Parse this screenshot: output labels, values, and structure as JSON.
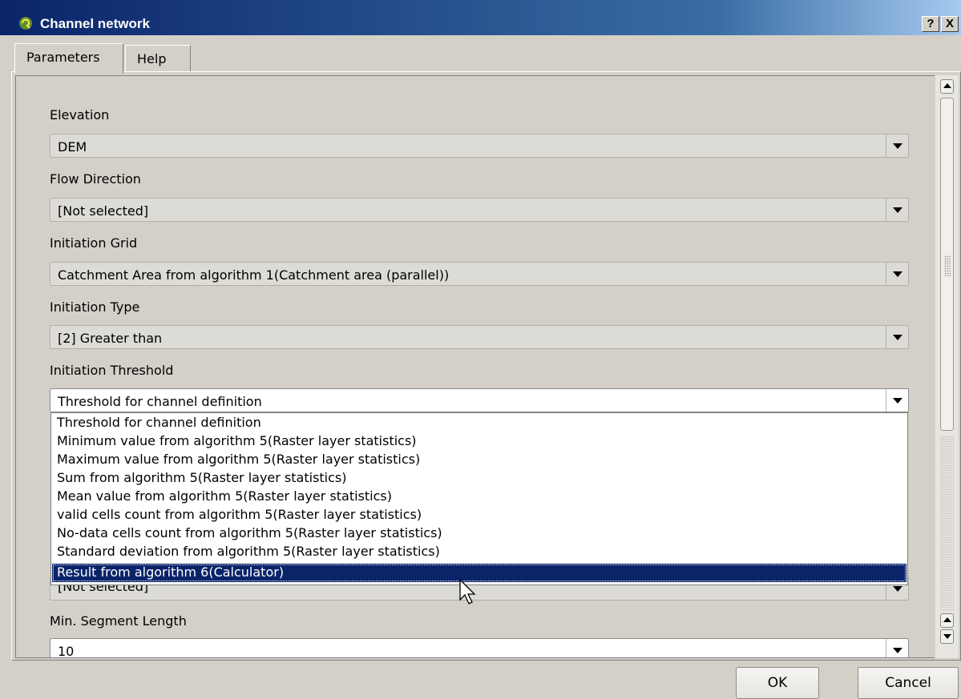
{
  "window": {
    "title": "Channel network",
    "help_button": "?",
    "close_button": "X"
  },
  "tabs": [
    {
      "label": "Parameters",
      "active": true
    },
    {
      "label": "Help",
      "active": false
    }
  ],
  "form": {
    "fields": [
      {
        "label": "Elevation",
        "value": "DEM"
      },
      {
        "label": "Flow Direction",
        "value": "[Not selected]"
      },
      {
        "label": "Initiation Grid",
        "value": "Catchment Area from algorithm 1(Catchment area (parallel))"
      },
      {
        "label": "Initiation Type",
        "value": "[2] Greater than"
      },
      {
        "label": "Initiation Threshold",
        "value": "Threshold for channel definition"
      }
    ],
    "hidden_field_value": "[Not selected]",
    "min_segment": {
      "label": "Min. Segment Length",
      "value": "10"
    }
  },
  "dropdown": {
    "items": [
      "Threshold for channel definition",
      "Minimum value from algorithm 5(Raster layer statistics)",
      "Maximum value from algorithm 5(Raster layer statistics)",
      "Sum from algorithm 5(Raster layer statistics)",
      "Mean value from algorithm 5(Raster layer statistics)",
      "valid cells count from algorithm 5(Raster layer statistics)",
      "No-data cells count from algorithm 5(Raster layer statistics)",
      "Standard deviation from algorithm 5(Raster layer statistics)",
      "Result from algorithm 6(Calculator)"
    ],
    "selected_index": 8
  },
  "buttons": {
    "ok": "OK",
    "cancel": "Cancel"
  },
  "colors": {
    "title_bar": "#0a246a",
    "selection": "#0a246a",
    "dialog_bg": "#d4d0c8"
  },
  "icons": {
    "title": "qgis-logo-icon",
    "dropdown": "chevron-down-icon",
    "scroll_up": "arrow-up-icon",
    "scroll_down": "arrow-down-icon",
    "cursor": "mouse-pointer-icon"
  }
}
